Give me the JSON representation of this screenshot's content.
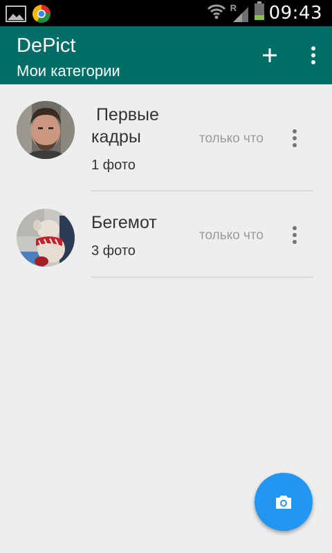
{
  "status_bar": {
    "time": "09:43",
    "left_icons": [
      "gallery-icon",
      "chrome-icon"
    ],
    "right_icons": [
      "wifi-icon",
      "roaming-icon",
      "signal-icon",
      "battery-icon"
    ],
    "roaming_label": "R"
  },
  "app_bar": {
    "title": "DePict",
    "subtitle": "Мои категории",
    "actions": [
      "add-icon",
      "overflow-menu-icon"
    ]
  },
  "categories": [
    {
      "name": "Первые кадры",
      "count": "1 фото",
      "time": "только что",
      "avatar": "person-photo"
    },
    {
      "name": "Бегемот",
      "count": "3 фото",
      "time": "только что",
      "avatar": "plush-toy-photo"
    }
  ],
  "fab": {
    "icon": "camera-icon"
  },
  "colors": {
    "app_bar": "#006d67",
    "background": "#eeeeee",
    "fab": "#2196f3",
    "divider": "#d9d9d9"
  }
}
